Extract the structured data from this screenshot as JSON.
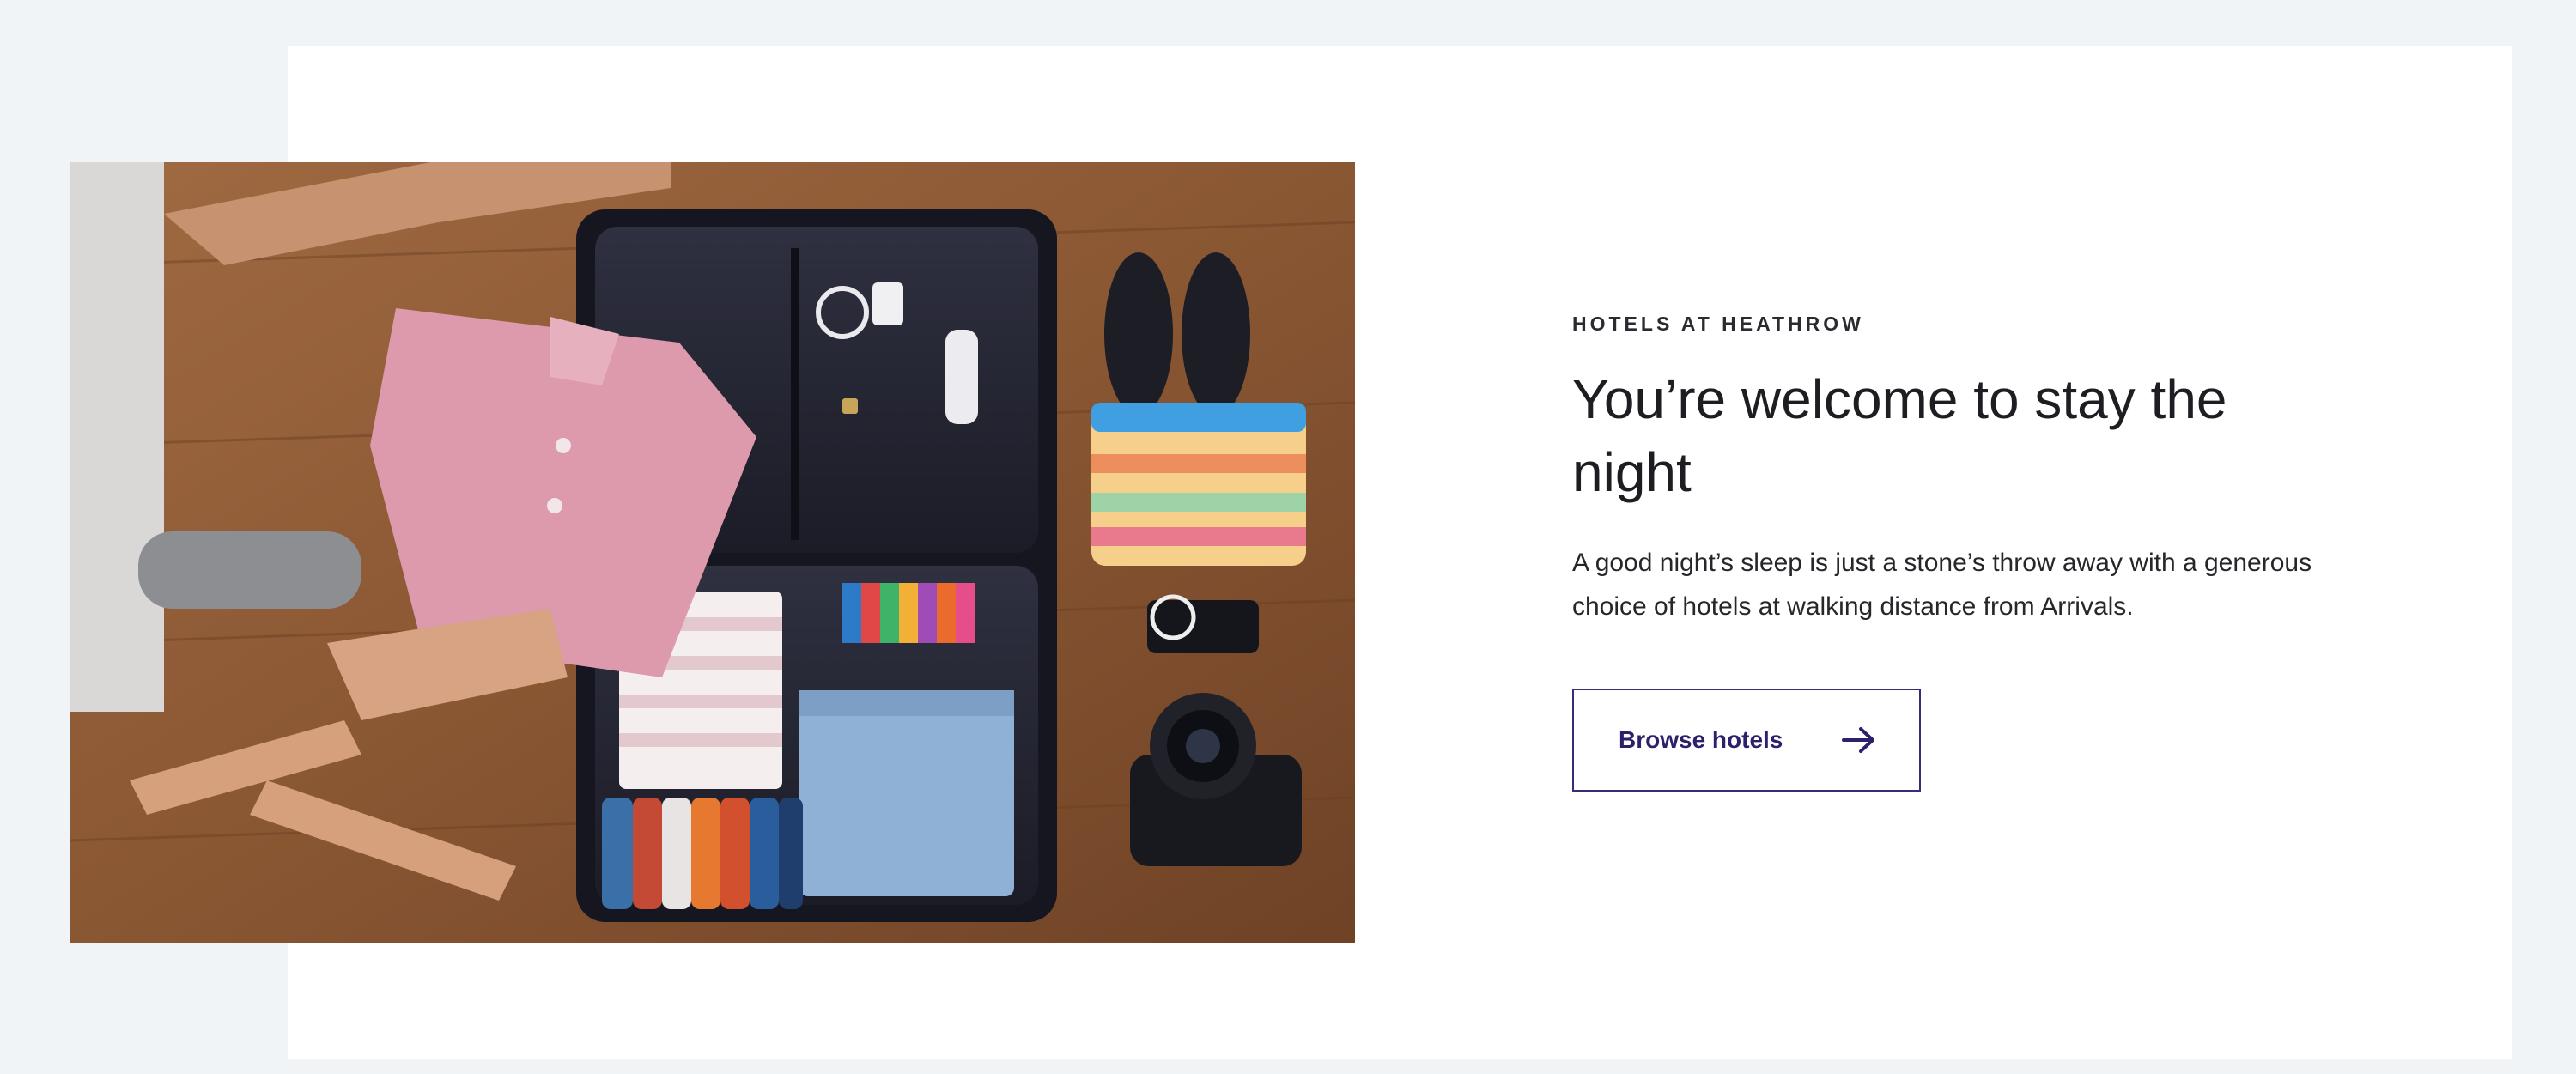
{
  "section": {
    "eyebrow": "HOTELS AT HEATHROW",
    "title": "You’re welcome to stay the night",
    "description": "A good night’s sleep is just a stone’s throw away with a generous choice of hotels at walking distance from Arrivals."
  },
  "cta": {
    "label": "Browse hotels",
    "icon": "arrow-right-icon"
  },
  "image": {
    "subject": "packing-suitcase-photo"
  },
  "colors": {
    "page_background": "#f1f4f7",
    "card_background": "#ffffff",
    "accent": "#2e1f6b",
    "text": "#1d1d22"
  }
}
